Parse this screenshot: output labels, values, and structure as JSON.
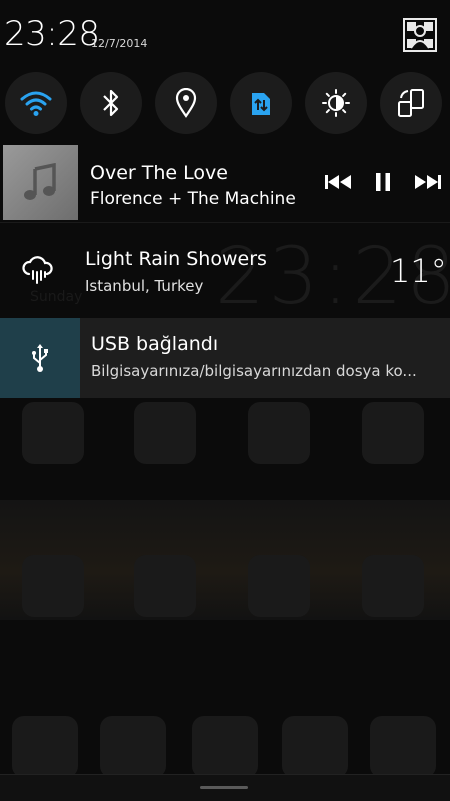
{
  "statusbar": {
    "time": "23:28",
    "date": "12/7/2014"
  },
  "toggles": [
    "wifi-icon",
    "bluetooth-icon",
    "location-icon",
    "data-sync-icon",
    "brightness-icon",
    "rotation-icon"
  ],
  "music": {
    "title": "Over The Love",
    "artist": "Florence + The Machine"
  },
  "weather": {
    "title": "Light Rain Showers",
    "location": "Istanbul, Turkey",
    "temperature": "11°"
  },
  "usb": {
    "title": "USB bağlandı",
    "subtitle": "Bilgisayarınıza/bilgisayarınızdan dosya ko..."
  },
  "colors": {
    "accent": "#2aa3f0",
    "usb_box": "#1f3f4a"
  }
}
